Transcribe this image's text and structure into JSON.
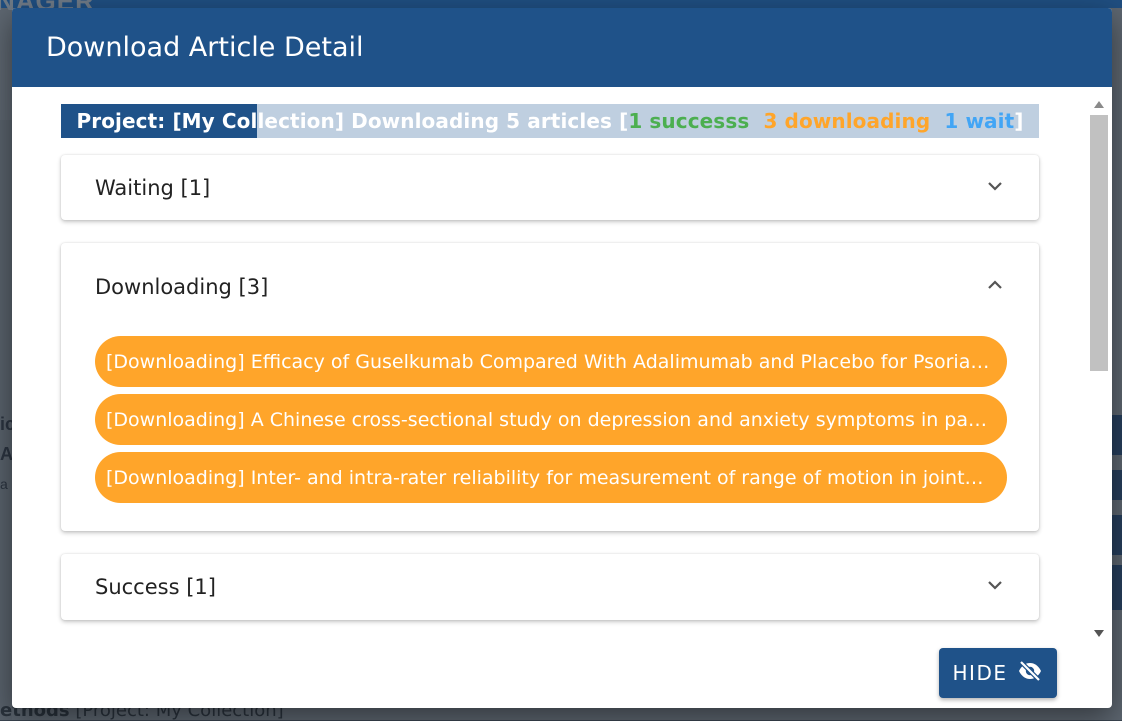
{
  "background": {
    "logo_fragment": "NAGER",
    "bottom_text_bold": "ethods",
    "bottom_text_rest": " [Project: My Collection]",
    "left_fragments": [
      "ic",
      "A",
      "a"
    ],
    "right_fragments": [
      "Y",
      "I",
      "T",
      "A"
    ]
  },
  "dialog": {
    "title": "Download Article Detail",
    "progress": {
      "prefix": "Project: [My Collection] Downloading 5 articles [",
      "success": "1 successs",
      "downloading": "3 downloading",
      "wait": "1 wait",
      "suffix": "]",
      "fraction_filled": 0.2
    },
    "panels": [
      {
        "label": "Waiting [1]",
        "expanded": false,
        "icon": "chevron-down-icon"
      },
      {
        "label": "Downloading [3]",
        "expanded": true,
        "icon": "chevron-up-icon",
        "items": [
          "[Downloading] Efficacy of Guselkumab Compared With Adalimumab and Placebo for Psoriasi...",
          "[Downloading] A Chinese cross-sectional study on depression and anxiety symptoms in patie...",
          "[Downloading] Inter- and intra-rater reliability for measurement of range of motion in joints i..."
        ]
      },
      {
        "label": "Success [1]",
        "expanded": false,
        "icon": "chevron-down-icon"
      }
    ],
    "hide_button": {
      "label": "HIDE",
      "icon": "eye-off-icon"
    }
  },
  "colors": {
    "primary": "#1f5289",
    "downloading": "#ffa52a",
    "success": "#4caf50",
    "wait": "#42a5f5"
  }
}
